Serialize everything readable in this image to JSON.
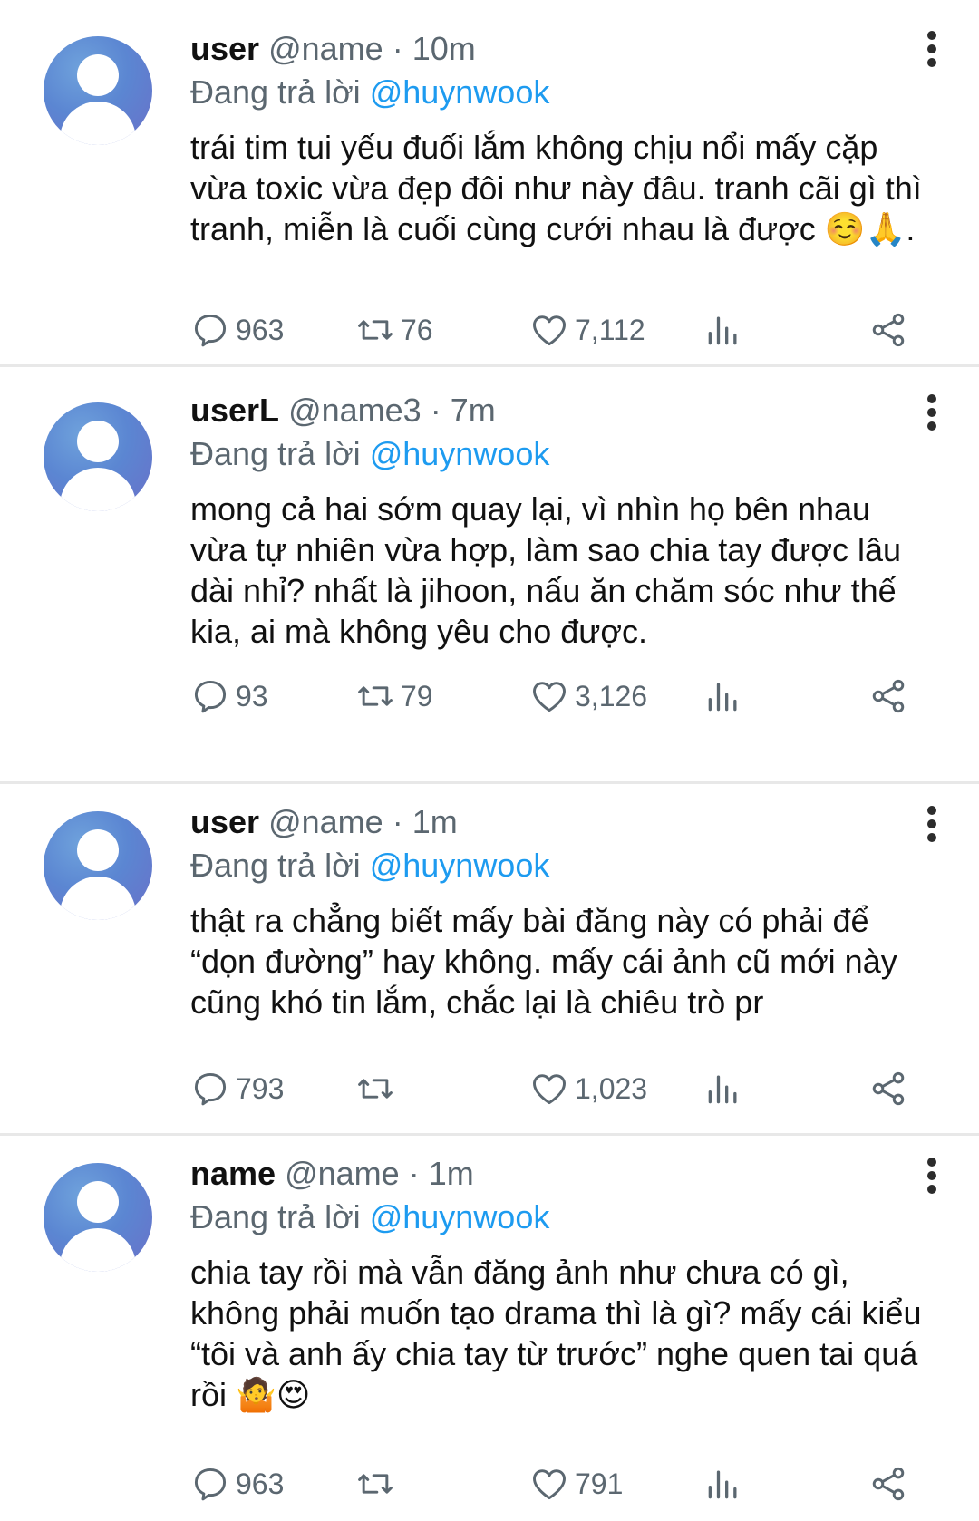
{
  "replying_prefix": "Đang trả lời",
  "separator": "·",
  "tweets": [
    {
      "display_name": "user",
      "handle": "@name",
      "time": "10m",
      "replying_to": "@huynwook",
      "text": "trái tim tui yếu đuối lắm không chịu nổi mấy cặp vừa toxic vừa đẹp đôi như này đâu. tranh cãi gì thì tranh, miễn là cuối cùng cưới nhau là được ☺️🙏.",
      "replies": "963",
      "retweets": "76",
      "likes": "7,112"
    },
    {
      "display_name": "userL",
      "handle": "@name3",
      "time": "7m",
      "replying_to": "@huynwook",
      "text": "mong cả hai sớm quay lại, vì nhìn họ bên nhau vừa tự nhiên vừa hợp, làm sao chia tay được lâu dài nhỉ? nhất là jihoon, nấu ăn chăm sóc như thế kia, ai mà không yêu cho được.",
      "replies": "93",
      "retweets": "79",
      "likes": "3,126"
    },
    {
      "display_name": "user",
      "handle": "@name",
      "time": "1m",
      "replying_to": "@huynwook",
      "text": "thật ra chẳng biết mấy bài đăng này có phải để “dọn đường” hay không. mấy cái ảnh cũ mới này cũng khó tin lắm, chắc lại là chiêu trò pr",
      "replies": "793",
      "retweets": "",
      "likes": "1,023"
    },
    {
      "display_name": "name",
      "handle": "@name",
      "time": "1m",
      "replying_to": "@huynwook",
      "text": "chia tay rồi mà vẫn đăng ảnh như chưa có gì, không phải muốn tạo drama thì là gì? mấy cái kiểu “tôi và anh ấy chia tay từ trước” nghe quen tai quá rồi 🤷😍",
      "replies": "963",
      "retweets": "",
      "likes": "791"
    }
  ]
}
